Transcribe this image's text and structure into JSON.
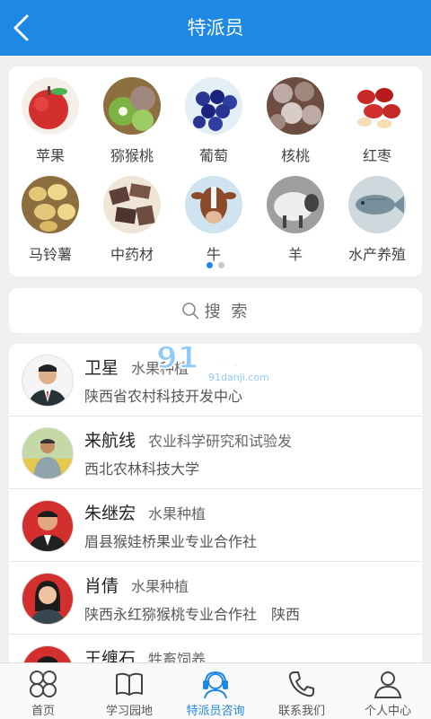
{
  "header": {
    "title": "特派员",
    "back_icon": "chevron-left-icon"
  },
  "categories": [
    {
      "label": "苹果",
      "icon": "apple-image"
    },
    {
      "label": "猕猴桃",
      "icon": "kiwi-image"
    },
    {
      "label": "葡萄",
      "icon": "grape-image"
    },
    {
      "label": "核桃",
      "icon": "walnut-image"
    },
    {
      "label": "红枣",
      "icon": "jujube-image"
    },
    {
      "label": "马铃薯",
      "icon": "potato-image"
    },
    {
      "label": "中药材",
      "icon": "herbal-medicine-image"
    },
    {
      "label": "牛",
      "icon": "cattle-image"
    },
    {
      "label": "羊",
      "icon": "sheep-image"
    },
    {
      "label": "水产养殖",
      "icon": "fish-image"
    }
  ],
  "carousel": {
    "pages": 2,
    "active": 1
  },
  "search": {
    "placeholder": "搜 索",
    "icon": "search-icon"
  },
  "experts": [
    {
      "name": "卫星",
      "field": "水果种植",
      "org": "陕西省农村科技开发中心"
    },
    {
      "name": "来航线",
      "field": "农业科学研究和试验发",
      "org": "西北农林科技大学"
    },
    {
      "name": "朱继宏",
      "field": "水果种植",
      "org": "眉县猴娃桥果业专业合作社"
    },
    {
      "name": "肖倩",
      "field": "水果种植",
      "org": "陕西永红猕猴桃专业合作社　陕西"
    },
    {
      "name": "王缠石",
      "field": "牲畜饲养",
      "org": ""
    }
  ],
  "watermark": {
    "text": "91游戏",
    "sub": "91danji.com"
  },
  "tabs": [
    {
      "label": "首页",
      "icon": "home-grid-icon",
      "active": false
    },
    {
      "label": "学习园地",
      "icon": "book-icon",
      "active": false
    },
    {
      "label": "特派员咨询",
      "icon": "headset-icon",
      "active": true
    },
    {
      "label": "联系我们",
      "icon": "phone-icon",
      "active": false
    },
    {
      "label": "个人中心",
      "icon": "person-icon",
      "active": false
    }
  ],
  "colors": {
    "accent": "#1e88e5",
    "background": "#f0f0f0"
  }
}
